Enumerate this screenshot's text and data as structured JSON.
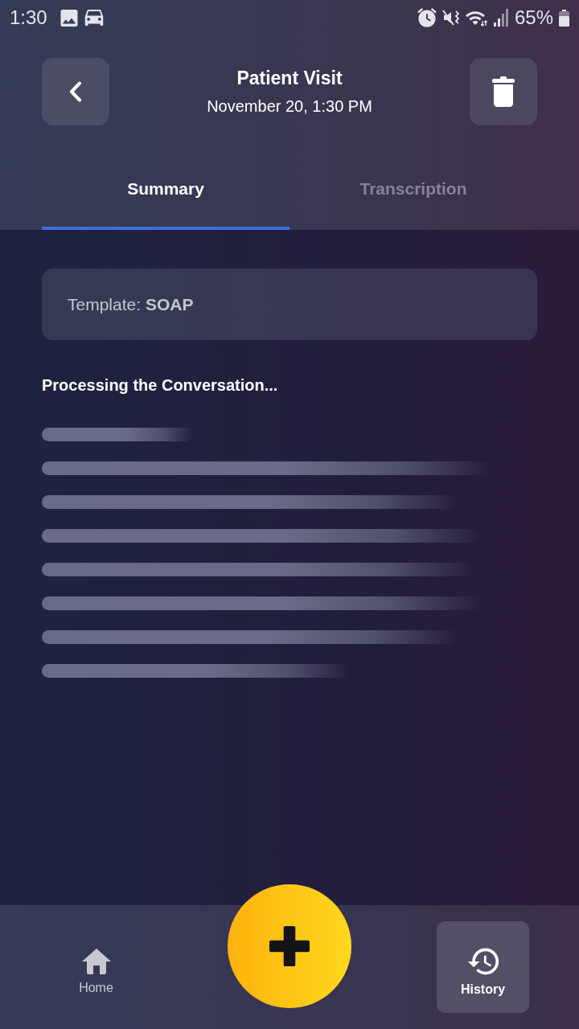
{
  "status_bar": {
    "time": "1:30",
    "battery": "65%"
  },
  "header": {
    "title": "Patient Visit",
    "subtitle": "November 20, 1:30 PM"
  },
  "tabs": [
    {
      "label": "Summary",
      "selected": true
    },
    {
      "label": "Transcription",
      "selected": false
    }
  ],
  "template": {
    "text": "Template: **SOAP**"
  },
  "status_message": "Processing the Conversation...",
  "bottom_nav": {
    "items": [
      {
        "label": "Home",
        "selected": false
      },
      {
        "label": "History",
        "selected": true
      }
    ]
  }
}
